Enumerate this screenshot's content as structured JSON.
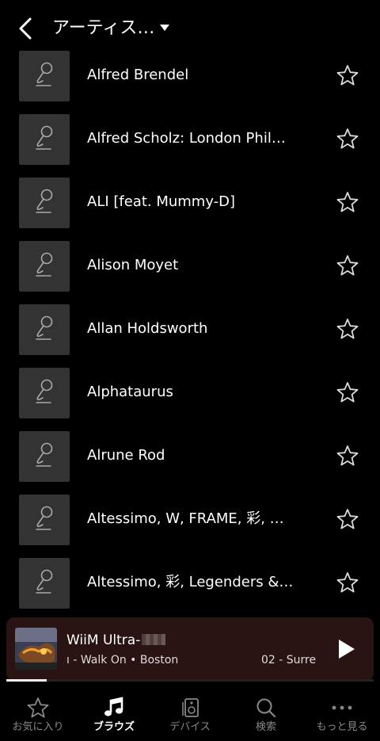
{
  "header": {
    "title": "アーティス…"
  },
  "artists": [
    {
      "name": "Alfred Brendel"
    },
    {
      "name": "Alfred Scholz: London Philharmonic Orchestra"
    },
    {
      "name": "ALI [feat. Mummy-D]"
    },
    {
      "name": "Alison Moyet"
    },
    {
      "name": "Allan Holdsworth"
    },
    {
      "name": "Alphataurus"
    },
    {
      "name": "Alrune Rod"
    },
    {
      "name": "Altessimo, W, FRAME, 彩, 神速一魂"
    },
    {
      "name": "Altessimo, 彩, Legenders & C...."
    }
  ],
  "now_playing": {
    "device": "WiiM Ultra-",
    "track": "ı - Walk On • Boston",
    "track_number": "02 - Surre",
    "progress": 0.11
  },
  "tabs": [
    {
      "label": "お気に入り",
      "icon": "star-icon"
    },
    {
      "label": "ブラウズ",
      "icon": "music-note-icon",
      "active": true
    },
    {
      "label": "デバイス",
      "icon": "speaker-icon"
    },
    {
      "label": "検索",
      "icon": "search-icon"
    },
    {
      "label": "もっと見る",
      "icon": "more-icon"
    }
  ]
}
